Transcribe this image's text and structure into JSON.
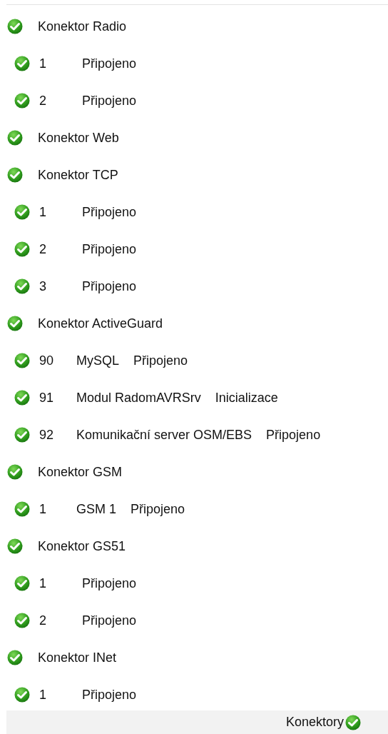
{
  "connectors": [
    {
      "name": "Konektor Radio",
      "ok": true,
      "children": [
        {
          "id": "1",
          "status": "Připojeno",
          "ok": true
        },
        {
          "id": "2",
          "status": "Připojeno",
          "ok": true
        }
      ]
    },
    {
      "name": "Konektor Web",
      "ok": true
    },
    {
      "name": "Konektor TCP",
      "ok": true,
      "children": [
        {
          "id": "1",
          "status": "Připojeno",
          "ok": true
        },
        {
          "id": "2",
          "status": "Připojeno",
          "ok": true
        },
        {
          "id": "3",
          "status": "Připojeno",
          "ok": true
        }
      ]
    },
    {
      "name": "Konektor ActiveGuard",
      "ok": true,
      "children": [
        {
          "id": "90",
          "name": "MySQL",
          "status": "Připojeno",
          "ok": true
        },
        {
          "id": "91",
          "name": "Modul RadomAVRSrv",
          "status": "Inicializace",
          "ok": true
        },
        {
          "id": "92",
          "name": "Komunikační server OSM/EBS",
          "status": "Připojeno",
          "ok": true
        }
      ]
    },
    {
      "name": "Konektor GSM",
      "ok": true,
      "children": [
        {
          "id": "1",
          "name": "GSM 1",
          "status": "Připojeno",
          "ok": true
        }
      ]
    },
    {
      "name": "Konektor GS51",
      "ok": true,
      "children": [
        {
          "id": "1",
          "status": "Připojeno",
          "ok": true
        },
        {
          "id": "2",
          "status": "Připojeno",
          "ok": true
        }
      ]
    },
    {
      "name": "Konektor INet",
      "ok": true,
      "children": [
        {
          "id": "1",
          "status": "Připojeno",
          "ok": true
        }
      ]
    }
  ],
  "status_bar": {
    "label": "Konektory",
    "ok": true
  }
}
